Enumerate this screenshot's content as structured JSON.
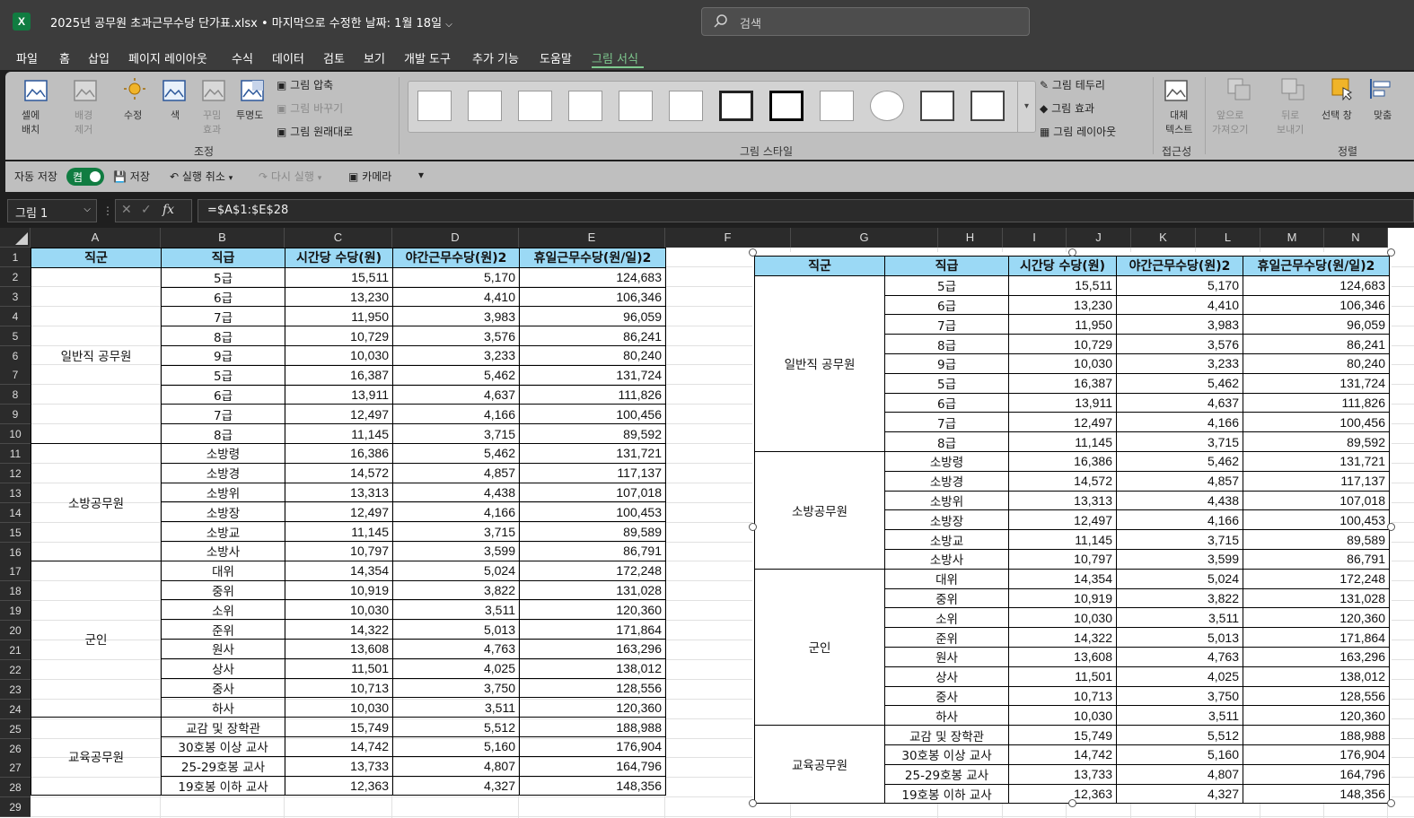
{
  "window": {
    "title": "2025년 공무원 초과근무수당 단가표.xlsx • 마지막으로 수정한 날짜: 1월 18일",
    "app_icon": "X",
    "search_placeholder": "검색"
  },
  "menu": [
    "파일",
    "홈",
    "삽입",
    "페이지 레이아웃",
    "수식",
    "데이터",
    "검토",
    "보기",
    "개발 도구",
    "추가 기능",
    "도움말",
    "그림 서식"
  ],
  "active_menu": "그림 서식",
  "ribbon": {
    "adjust": {
      "bg_remove": [
        "배경",
        "제거"
      ],
      "layout_cell": [
        "셀에",
        "배치"
      ],
      "correct": "수정",
      "color": "색",
      "artistic": [
        "꾸밈",
        "효과"
      ],
      "transparency": "투명도",
      "compress": "그림 압축",
      "change": "그림 바꾸기",
      "reset": "그림 원래대로",
      "caption": "조정"
    },
    "styles": {
      "caption": "그림 스타일",
      "border": "그림 테두리",
      "effects": "그림 효과",
      "layout": "그림 레이아웃"
    },
    "accessibility": {
      "alt_text": [
        "대체",
        "텍스트"
      ],
      "caption": "접근성"
    },
    "arrange": {
      "bring_forward": [
        "앞으로",
        "가져오기"
      ],
      "send_backward": [
        "뒤로",
        "보내기"
      ],
      "selection_pane": "선택 창",
      "align": "맞춤",
      "caption": "정렬"
    }
  },
  "qat": {
    "autosave": "자동 저장",
    "toggle": "켬",
    "save": "저장",
    "undo": "실행 취소",
    "redo": "다시 실행",
    "camera": "카메라"
  },
  "formula_bar": {
    "name_box": "그림 1",
    "fx": "fx",
    "formula": "=$A$1:$E$28"
  },
  "columns": [
    "A",
    "B",
    "C",
    "D",
    "E",
    "F",
    "G",
    "H",
    "I",
    "J",
    "K",
    "L",
    "M",
    "N"
  ],
  "rows": [
    "1",
    "2",
    "3",
    "4",
    "5",
    "6",
    "7",
    "8",
    "9",
    "10",
    "11",
    "12",
    "13",
    "14",
    "15",
    "16",
    "17",
    "18",
    "19",
    "20",
    "21",
    "22",
    "23",
    "24",
    "25",
    "26",
    "27",
    "28",
    "29"
  ],
  "table": {
    "headers": [
      "직군",
      "직급",
      "시간당 수당(원)",
      "야간근무수당(원)2",
      "휴일근무수당(원/일)2"
    ],
    "groups": [
      {
        "name": "일반직 공무원",
        "rows": [
          [
            "5급",
            "15,511",
            "5,170",
            "124,683"
          ],
          [
            "6급",
            "13,230",
            "4,410",
            "106,346"
          ],
          [
            "7급",
            "11,950",
            "3,983",
            "96,059"
          ],
          [
            "8급",
            "10,729",
            "3,576",
            "86,241"
          ],
          [
            "9급",
            "10,030",
            "3,233",
            "80,240"
          ],
          [
            "5급",
            "16,387",
            "5,462",
            "131,724"
          ],
          [
            "6급",
            "13,911",
            "4,637",
            "111,826"
          ],
          [
            "7급",
            "12,497",
            "4,166",
            "100,456"
          ],
          [
            "8급",
            "11,145",
            "3,715",
            "89,592"
          ]
        ]
      },
      {
        "name": "소방공무원",
        "rows": [
          [
            "소방령",
            "16,386",
            "5,462",
            "131,721"
          ],
          [
            "소방경",
            "14,572",
            "4,857",
            "117,137"
          ],
          [
            "소방위",
            "13,313",
            "4,438",
            "107,018"
          ],
          [
            "소방장",
            "12,497",
            "4,166",
            "100,453"
          ],
          [
            "소방교",
            "11,145",
            "3,715",
            "89,589"
          ],
          [
            "소방사",
            "10,797",
            "3,599",
            "86,791"
          ]
        ]
      },
      {
        "name": "군인",
        "rows": [
          [
            "대위",
            "14,354",
            "5,024",
            "172,248"
          ],
          [
            "중위",
            "10,919",
            "3,822",
            "131,028"
          ],
          [
            "소위",
            "10,030",
            "3,511",
            "120,360"
          ],
          [
            "준위",
            "14,322",
            "5,013",
            "171,864"
          ],
          [
            "원사",
            "13,608",
            "4,763",
            "163,296"
          ],
          [
            "상사",
            "11,501",
            "4,025",
            "138,012"
          ],
          [
            "중사",
            "10,713",
            "3,750",
            "128,556"
          ],
          [
            "하사",
            "10,030",
            "3,511",
            "120,360"
          ]
        ]
      },
      {
        "name": "교육공무원",
        "rows": [
          [
            "교감 및 장학관",
            "15,749",
            "5,512",
            "188,988"
          ],
          [
            "30호봉 이상 교사",
            "14,742",
            "5,160",
            "176,904"
          ],
          [
            "25-29호봉 교사",
            "13,733",
            "4,807",
            "164,796"
          ],
          [
            "19호봉 이하 교사",
            "12,363",
            "4,327",
            "148,356"
          ]
        ]
      }
    ]
  }
}
